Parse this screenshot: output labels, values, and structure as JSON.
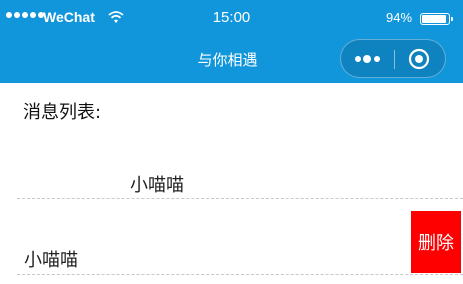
{
  "status_bar": {
    "carrier": "WeChat",
    "time": "15:00",
    "battery": "94%",
    "battery_level": 0.94,
    "icons": [
      "signal-dots-icon",
      "wifi-icon",
      "battery-icon"
    ]
  },
  "nav": {
    "title": "与你相遇",
    "capsule_icons": [
      "more-icon",
      "close-icon"
    ],
    "background": "#1296db"
  },
  "page": {
    "heading": "消息列表:",
    "messages": [
      {
        "name": "小喵喵"
      },
      {
        "name": "小喵喵",
        "action": "删除"
      }
    ],
    "delete_color": "#ff0000"
  }
}
